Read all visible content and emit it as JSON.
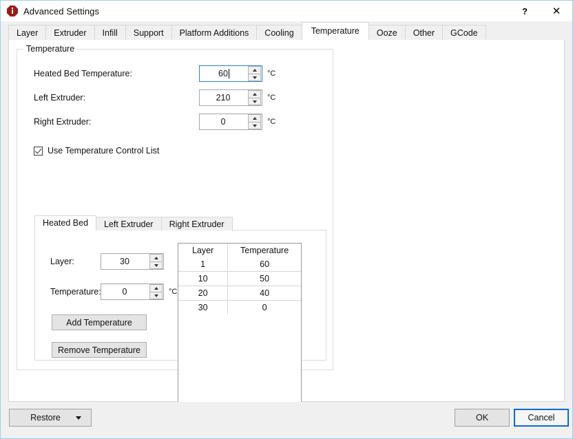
{
  "window": {
    "title": "Advanced Settings",
    "icon": "info-octagon-icon",
    "help_label": "?",
    "close_label": "✕",
    "border_color": "#9cd0f5"
  },
  "tabs": [
    {
      "label": "Layer",
      "active": false
    },
    {
      "label": "Extruder",
      "active": false
    },
    {
      "label": "Infill",
      "active": false
    },
    {
      "label": "Support",
      "active": false
    },
    {
      "label": "Platform Additions",
      "active": false
    },
    {
      "label": "Cooling",
      "active": false
    },
    {
      "label": "Temperature",
      "active": true
    },
    {
      "label": "Ooze",
      "active": false
    },
    {
      "label": "Other",
      "active": false
    },
    {
      "label": "GCode",
      "active": false
    }
  ],
  "temperature_group": {
    "title": "Temperature",
    "unit": "°C",
    "fields": [
      {
        "label": "Heated Bed Temperature:",
        "value": "60",
        "unit": "°C",
        "focused": true
      },
      {
        "label": "Left Extruder:",
        "value": "210",
        "unit": "°C",
        "focused": false
      },
      {
        "label": "Right Extruder:",
        "value": "0",
        "unit": "°C",
        "focused": false
      }
    ],
    "checkbox": {
      "label": "Use Temperature Control List",
      "checked": true
    }
  },
  "inner_tabs": [
    {
      "label": "Heated Bed",
      "active": true
    },
    {
      "label": "Left Extruder",
      "active": false
    },
    {
      "label": "Right Extruder",
      "active": false
    }
  ],
  "control_list": {
    "layer_field": {
      "label": "Layer:",
      "value": "30"
    },
    "temperature_field": {
      "label": "Temperature:",
      "value": "0",
      "unit": "°C"
    },
    "add_button": "Add Temperature",
    "remove_button": "Remove Temperature",
    "table": {
      "columns": [
        "Layer",
        "Temperature"
      ],
      "rows": [
        [
          "1",
          "60"
        ],
        [
          "10",
          "50"
        ],
        [
          "20",
          "40"
        ],
        [
          "30",
          "0"
        ]
      ]
    }
  },
  "footer": {
    "restore_label": "Restore",
    "ok_label": "OK",
    "cancel_label": "Cancel",
    "focus_color": "#0a6cd0"
  }
}
